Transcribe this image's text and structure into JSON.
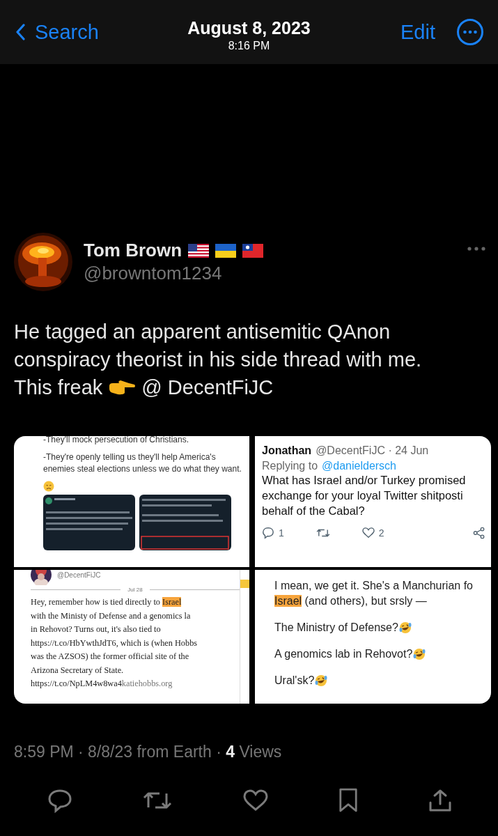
{
  "nav": {
    "back": "Search",
    "date": "August 8, 2023",
    "time": "8:16 PM",
    "edit": "Edit"
  },
  "tweet": {
    "name": "Tom Brown",
    "handle": "@browntom1234",
    "body": [
      {
        "kind": "text",
        "text": "He tagged an apparent antisemitic QAnon"
      },
      {
        "kind": "text",
        "text": "conspiracy theorist in his side thread with me."
      },
      {
        "kind": "pointer",
        "text": "This freak",
        "after": "@ DecentFiJC"
      }
    ],
    "images": [
      {
        "kind": "thread",
        "lines": [
          "-They'll mock persecution of Christians.",
          "-They're openly telling us they'll help America's enemies steal elections unless we do what they want."
        ]
      },
      {
        "kind": "reply",
        "name": "Jonathan",
        "meta": "@DecentFiJC · 24 Jun",
        "replying": "Replying to",
        "replying_to": "@danieldersch",
        "lines": [
          "What has Israel and/or Turkey promised",
          "exchange for your loyal Twitter shitposti",
          "behalf of the Cabal?"
        ],
        "replies": "1",
        "likes": "2"
      },
      {
        "kind": "article",
        "handle": "@DecentFiJC",
        "date": "Jul 28",
        "lines": [
          [
            {
              "kind": "plain",
              "text": "Hey, remember how is tied directly to "
            },
            {
              "kind": "highlight",
              "text": "Israel"
            }
          ],
          [
            {
              "kind": "plain",
              "text": "with the Ministy of Defense and a genomics la"
            }
          ],
          [
            {
              "kind": "plain",
              "text": "in Rehovot? Turns out, it's also tied to"
            }
          ],
          [
            {
              "kind": "plain",
              "text": "https://t.co/HbYwthJdT6, which is (when Hobbs"
            }
          ],
          [
            {
              "kind": "plain",
              "text": "was the AZSOS) the former official site of the"
            }
          ],
          [
            {
              "kind": "plain",
              "text": "Arizona Secretary of State."
            }
          ],
          [
            {
              "kind": "plain",
              "text": "https://t.co/NpLM4w8wa4"
            },
            {
              "kind": "muted",
              "text": "katiehobbs.org"
            }
          ]
        ]
      },
      {
        "kind": "note",
        "paragraphs": [
          {
            "kind": "text",
            "lines": [
              [
                {
                  "kind": "plain",
                  "text": "I mean, we get it. She's a Manchurian fo"
                }
              ],
              [
                {
                  "kind": "highlight",
                  "text": "Israel"
                },
                {
                  "kind": "plain",
                  "text": " (and others), but srsly —"
                }
              ]
            ]
          },
          {
            "kind": "laugh",
            "lines": [
              [
                {
                  "kind": "plain",
                  "text": "The Ministry of Defense?"
                }
              ]
            ]
          },
          {
            "kind": "laugh",
            "lines": [
              [
                {
                  "kind": "plain",
                  "text": "A genomics lab in Rehovot?"
                }
              ]
            ]
          },
          {
            "kind": "laugh",
            "lines": [
              [
                {
                  "kind": "plain",
                  "text": "Ural'sk?"
                }
              ]
            ]
          }
        ]
      }
    ],
    "meta": {
      "time": "8:59 PM · 8/8/23 from Earth · ",
      "views": "4",
      "views_label": " Views"
    }
  }
}
